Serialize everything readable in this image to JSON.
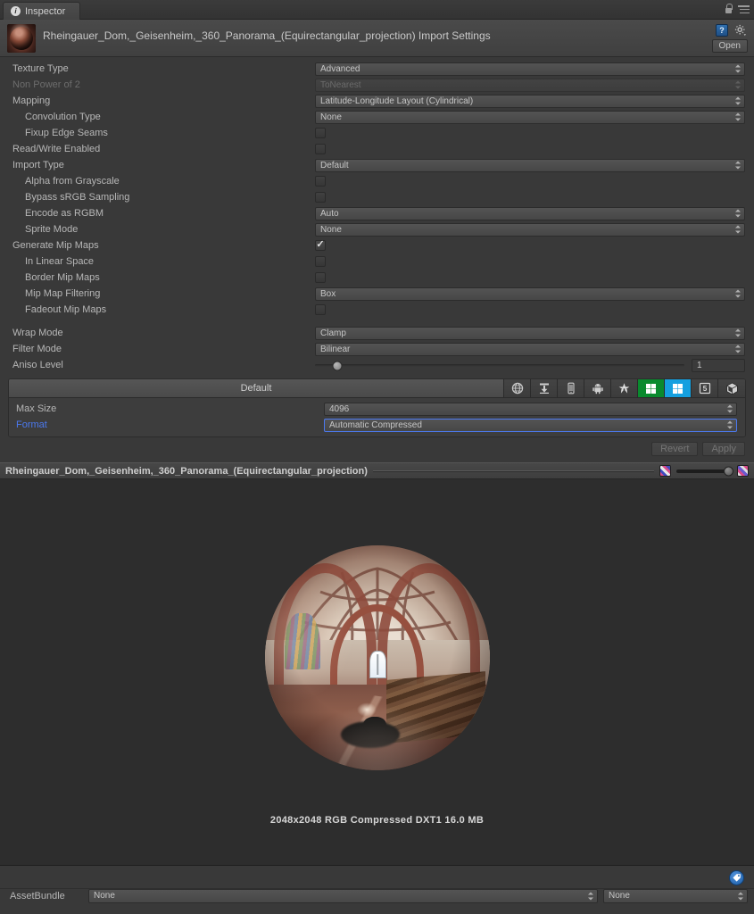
{
  "window": {
    "tab_label": "Inspector",
    "tab_icon": "info-icon",
    "lock_icon": "lock-icon",
    "menu_icon": "hamburger-menu-icon"
  },
  "object_header": {
    "title": "Rheingauer_Dom,_Geisenheim,_360_Panorama_(Equirectangular_projection) Import Settings",
    "help_icon": "book-help-icon",
    "settings_icon": "gear-icon",
    "open_button": "Open",
    "thumbnail": "texture-thumbnail"
  },
  "import_settings": {
    "rows": [
      {
        "label": "Texture Type",
        "type": "dropdown",
        "value": "Advanced",
        "indent": 0,
        "disabled": false
      },
      {
        "label": "Non Power of 2",
        "type": "dropdown",
        "value": "ToNearest",
        "indent": 0,
        "disabled": true
      },
      {
        "label": "Mapping",
        "type": "dropdown",
        "value": "Latitude-Longitude Layout (Cylindrical)",
        "indent": 0,
        "disabled": false
      },
      {
        "label": "Convolution Type",
        "type": "dropdown",
        "value": "None",
        "indent": 1,
        "disabled": false
      },
      {
        "label": "Fixup Edge Seams",
        "type": "checkbox",
        "value": false,
        "indent": 1,
        "disabled": false
      },
      {
        "label": "Read/Write Enabled",
        "type": "checkbox",
        "value": false,
        "indent": 0,
        "disabled": false
      },
      {
        "label": "Import Type",
        "type": "dropdown",
        "value": "Default",
        "indent": 0,
        "disabled": false
      },
      {
        "label": "Alpha from Grayscale",
        "type": "checkbox",
        "value": false,
        "indent": 1,
        "disabled": false
      },
      {
        "label": "Bypass sRGB Sampling",
        "type": "checkbox",
        "value": false,
        "indent": 1,
        "disabled": false
      },
      {
        "label": "Encode as RGBM",
        "type": "dropdown",
        "value": "Auto",
        "indent": 1,
        "disabled": false
      },
      {
        "label": "Sprite Mode",
        "type": "dropdown",
        "value": "None",
        "indent": 1,
        "disabled": false
      },
      {
        "label": "Generate Mip Maps",
        "type": "checkbox",
        "value": true,
        "indent": 0,
        "disabled": false
      },
      {
        "label": "In Linear Space",
        "type": "checkbox",
        "value": false,
        "indent": 1,
        "disabled": false
      },
      {
        "label": "Border Mip Maps",
        "type": "checkbox",
        "value": false,
        "indent": 1,
        "disabled": false
      },
      {
        "label": "Mip Map Filtering",
        "type": "dropdown",
        "value": "Box",
        "indent": 1,
        "disabled": false
      },
      {
        "label": "Fadeout Mip Maps",
        "type": "checkbox",
        "value": false,
        "indent": 1,
        "disabled": false
      },
      {
        "label": "",
        "type": "spacer",
        "value": "",
        "indent": 0,
        "disabled": false
      },
      {
        "label": "Wrap Mode",
        "type": "dropdown",
        "value": "Clamp",
        "indent": 0,
        "disabled": false
      },
      {
        "label": "Filter Mode",
        "type": "dropdown",
        "value": "Bilinear",
        "indent": 0,
        "disabled": false
      }
    ],
    "aniso": {
      "label": "Aniso Level",
      "value": "1",
      "slider_percent": 6
    }
  },
  "platform_panel": {
    "default_tab": "Default",
    "platform_icons": [
      "web-globe-icon",
      "standalone-download-icon",
      "ios-device-icon",
      "android-icon",
      "tizen-icon",
      "windows-store-icon",
      "windows-phone-icon",
      "html5-icon",
      "webgl-box-icon"
    ],
    "rows": [
      {
        "label": "Max Size",
        "value": "4096",
        "accent": false,
        "focused": false
      },
      {
        "label": "Format",
        "value": "Automatic Compressed",
        "accent": true,
        "focused": true
      }
    ],
    "revert_button": "Revert",
    "apply_button": "Apply"
  },
  "preview": {
    "title": "Rheingauer_Dom,_Geisenheim,_360_Panorama_(Equirectangular_projection)",
    "mip_left_icon": "checker-swatch-icon",
    "mip_right_icon": "checker-swatch-icon",
    "mip_slider_percent": 100,
    "info": "2048x2048  RGB Compressed DXT1   16.0 MB",
    "sphere_alt": "360-panorama-sphere-preview"
  },
  "asset_bundle": {
    "label": "AssetBundle",
    "name_value": "None",
    "variant_value": "None",
    "tag_icon": "asset-label-tag-icon"
  },
  "colors": {
    "background": "#393939",
    "accent_blue": "#4b79f0",
    "text": "#b6b6b6",
    "preview_bg": "#2d2d2d"
  }
}
